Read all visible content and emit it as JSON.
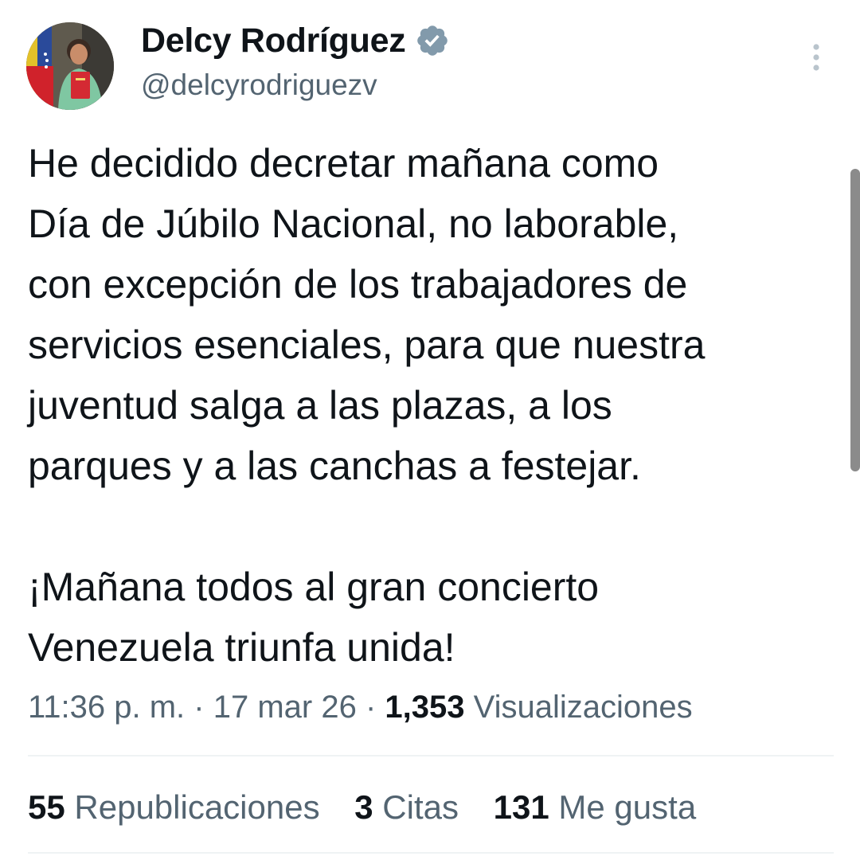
{
  "author": {
    "display_name": "Delcy Rodríguez",
    "handle": "@delcyrodriguezv",
    "verified_icon": "verified-badge-icon",
    "badge_color": "#829aab"
  },
  "menu": {
    "icon": "more-vertical-icon"
  },
  "tweet": {
    "lines": [
      "He decidido decretar mañana como",
      "Día de Júbilo Nacional, no laborable,",
      "con excepción de los trabajadores de",
      "servicios esenciales, para que nuestra",
      "juventud salga a las plazas, a los",
      "parques y a las canchas a festejar."
    ],
    "lines_2": [
      "¡Mañana todos al gran concierto",
      "Venezuela triunfa unida!"
    ]
  },
  "meta": {
    "time": "11:36 p. m.",
    "separator": "·",
    "date": "17 mar 26",
    "views_count": "1,353",
    "views_label": "Visualizaciones"
  },
  "stats": {
    "reposts_count": "55",
    "reposts_label": "Republicaciones",
    "quotes_count": "3",
    "quotes_label": "Citas",
    "likes_count": "131",
    "likes_label": "Me gusta"
  },
  "colors": {
    "text": "#0f1419",
    "secondary": "#536471",
    "divider": "#eff3f4"
  }
}
